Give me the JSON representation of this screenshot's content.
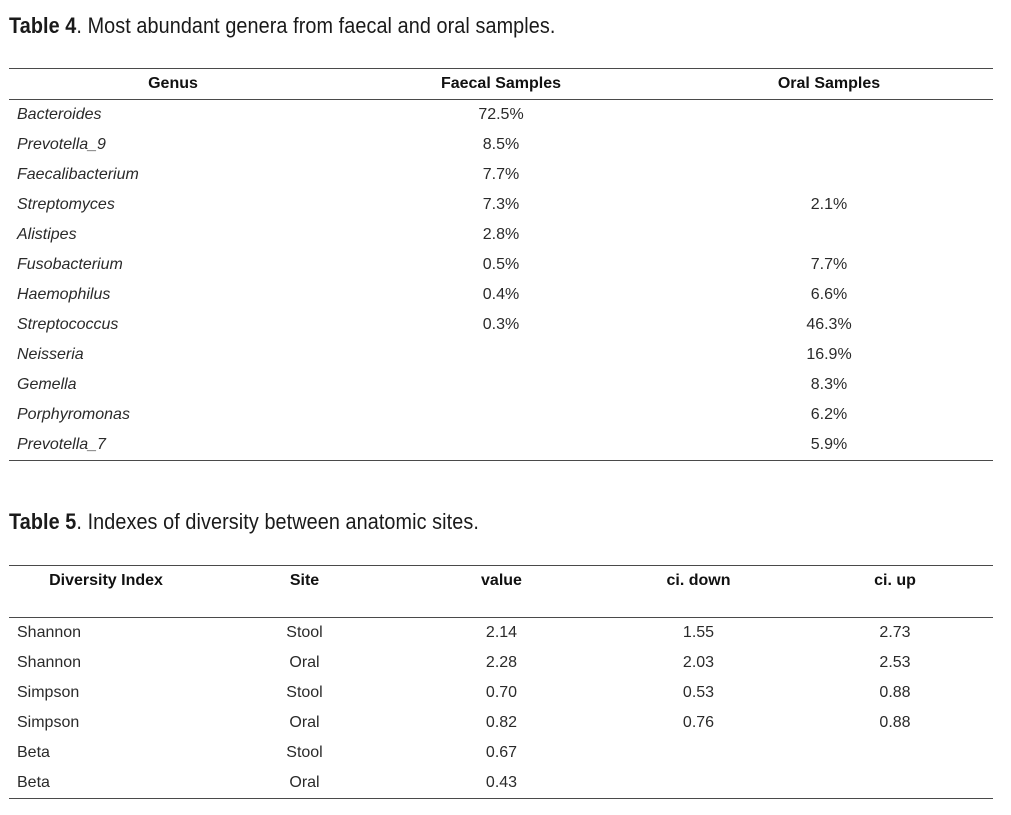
{
  "table4": {
    "caption_label": "Table 4",
    "caption_text": ". Most abundant genera from faecal and oral samples.",
    "headers": [
      "Genus",
      "Faecal Samples",
      "Oral Samples"
    ],
    "rows": [
      {
        "genus": "Bacteroides",
        "faecal": "72.5%",
        "oral": ""
      },
      {
        "genus": "Prevotella_9",
        "faecal": "8.5%",
        "oral": ""
      },
      {
        "genus": "Faecalibacterium",
        "faecal": "7.7%",
        "oral": ""
      },
      {
        "genus": "Streptomyces",
        "faecal": "7.3%",
        "oral": "2.1%"
      },
      {
        "genus": "Alistipes",
        "faecal": "2.8%",
        "oral": ""
      },
      {
        "genus": "Fusobacterium",
        "faecal": "0.5%",
        "oral": "7.7%"
      },
      {
        "genus": "Haemophilus",
        "faecal": "0.4%",
        "oral": "6.6%"
      },
      {
        "genus": "Streptococcus",
        "faecal": "0.3%",
        "oral": "46.3%"
      },
      {
        "genus": "Neisseria",
        "faecal": "",
        "oral": "16.9%"
      },
      {
        "genus": "Gemella",
        "faecal": "",
        "oral": "8.3%"
      },
      {
        "genus": "Porphyromonas",
        "faecal": "",
        "oral": "6.2%"
      },
      {
        "genus": "Prevotella_7",
        "faecal": "",
        "oral": "5.9%"
      }
    ]
  },
  "table5": {
    "caption_label": "Table 5",
    "caption_text": ". Indexes of diversity between anatomic sites.",
    "headers": [
      "Diversity Index",
      "Site",
      "value",
      "ci. down",
      "ci. up"
    ],
    "rows": [
      {
        "index": "Shannon",
        "site": "Stool",
        "value": "2.14",
        "ci_down": "1.55",
        "ci_up": "2.73"
      },
      {
        "index": "Shannon",
        "site": "Oral",
        "value": "2.28",
        "ci_down": "2.03",
        "ci_up": "2.53"
      },
      {
        "index": "Simpson",
        "site": "Stool",
        "value": "0.70",
        "ci_down": "0.53",
        "ci_up": "0.88"
      },
      {
        "index": "Simpson",
        "site": "Oral",
        "value": "0.82",
        "ci_down": "0.76",
        "ci_up": "0.88"
      },
      {
        "index": "Beta",
        "site": "Stool",
        "value": "0.67",
        "ci_down": "",
        "ci_up": ""
      },
      {
        "index": "Beta",
        "site": "Oral",
        "value": "0.43",
        "ci_down": "",
        "ci_up": ""
      }
    ]
  }
}
